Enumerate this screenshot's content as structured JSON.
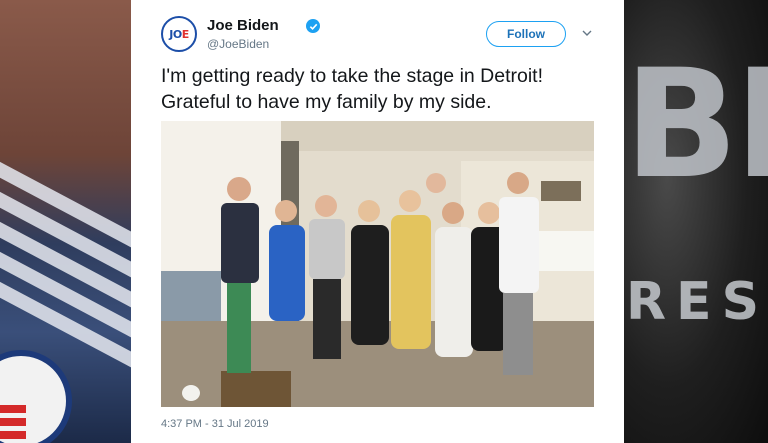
{
  "tweet": {
    "author_name": "Joe Biden",
    "author_handle": "@JoeBiden",
    "avatar_text_main": "JO",
    "avatar_text_accent": "E",
    "follow_label": "Follow",
    "text_line1": "I'm getting ready to take the stage in Detroit!",
    "text_line2": "Grateful to have my family by my side.",
    "timestamp": "4:37 PM - 31 Jul 2019"
  },
  "background": {
    "right_big_text": "BI",
    "right_small_text": "RES",
    "left_badge_text": "E"
  },
  "colors": {
    "verified": "#1da1f2",
    "follow_border": "#1da1f2",
    "brand_blue": "#1c4ea8",
    "brand_red": "#e0312f"
  },
  "icons": [
    "verified-badge-icon",
    "chevron-down-icon"
  ]
}
